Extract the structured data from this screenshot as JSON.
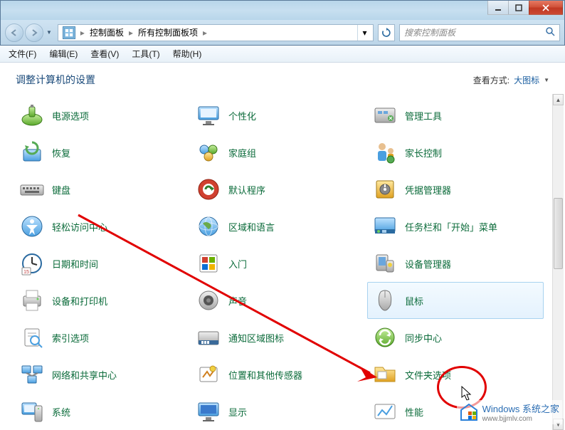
{
  "window": {
    "min_tip": "最小化",
    "max_tip": "最大化",
    "close_tip": "关闭"
  },
  "breadcrumb": {
    "root": "控制面板",
    "current": "所有控制面板项"
  },
  "search": {
    "placeholder": "搜索控制面板"
  },
  "menu": {
    "file": "文件(F)",
    "edit": "编辑(E)",
    "view": "查看(V)",
    "tools": "工具(T)",
    "help": "帮助(H)"
  },
  "header": {
    "title": "调整计算机的设置",
    "view_label": "查看方式:",
    "view_value": "大图标"
  },
  "items": [
    {
      "id": "power-options",
      "label": "电源选项",
      "icon": "battery"
    },
    {
      "id": "personalization",
      "label": "个性化",
      "icon": "monitor"
    },
    {
      "id": "admin-tools",
      "label": "管理工具",
      "icon": "tools"
    },
    {
      "id": "recovery",
      "label": "恢复",
      "icon": "recovery"
    },
    {
      "id": "homegroup",
      "label": "家庭组",
      "icon": "homegroup"
    },
    {
      "id": "parental",
      "label": "家长控制",
      "icon": "parental"
    },
    {
      "id": "keyboard",
      "label": "键盘",
      "icon": "keyboard"
    },
    {
      "id": "default-programs",
      "label": "默认程序",
      "icon": "default-prog"
    },
    {
      "id": "credential-manager",
      "label": "凭据管理器",
      "icon": "vault"
    },
    {
      "id": "ease-of-access",
      "label": "轻松访问中心",
      "icon": "ease"
    },
    {
      "id": "region-language",
      "label": "区域和语言",
      "icon": "globe"
    },
    {
      "id": "taskbar-start",
      "label": "任务栏和「开始」菜单",
      "icon": "taskbar"
    },
    {
      "id": "date-time",
      "label": "日期和时间",
      "icon": "clock"
    },
    {
      "id": "getting-started",
      "label": "入门",
      "icon": "getting-started"
    },
    {
      "id": "device-manager",
      "label": "设备管理器",
      "icon": "device-mgr"
    },
    {
      "id": "devices-printers",
      "label": "设备和打印机",
      "icon": "printer"
    },
    {
      "id": "sound",
      "label": "声音",
      "icon": "speaker"
    },
    {
      "id": "mouse",
      "label": "鼠标",
      "icon": "mouse",
      "selected": true
    },
    {
      "id": "indexing",
      "label": "索引选项",
      "icon": "index"
    },
    {
      "id": "notification-icons",
      "label": "通知区域图标",
      "icon": "tray"
    },
    {
      "id": "sync-center",
      "label": "同步中心",
      "icon": "sync"
    },
    {
      "id": "network-sharing",
      "label": "网络和共享中心",
      "icon": "network"
    },
    {
      "id": "location-sensors",
      "label": "位置和其他传感器",
      "icon": "location"
    },
    {
      "id": "folder-options",
      "label": "文件夹选项",
      "icon": "folder"
    },
    {
      "id": "system",
      "label": "系统",
      "icon": "system"
    },
    {
      "id": "display",
      "label": "显示",
      "icon": "display"
    },
    {
      "id": "performance",
      "label": "性能",
      "icon": "perf"
    }
  ],
  "watermark": {
    "brand": "Windows 系统之家",
    "url": "www.bjjmlv.com"
  },
  "colors": {
    "link": "#0b6b3a",
    "header": "#1a4a7a",
    "annotation": "#e10000"
  }
}
